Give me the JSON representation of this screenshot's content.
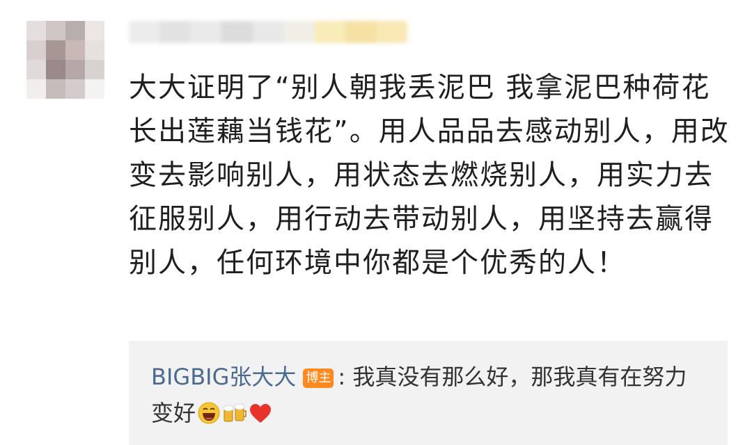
{
  "comment": {
    "text": "大大证明了“别人朝我丢泥巴 我拿泥巴种荷花 长出莲藕当钱花”。用人品品去感动别人，用改变去影响别人，用状态去燃烧别人，用实力去征服别人，用行动去带动别人，用坚持去赢得别人，任何环境中你都是个优秀的人！"
  },
  "reply": {
    "username": "BIGBIG张大大",
    "badge": "博主",
    "text": ":  我真没有那么好，那我真有在努力变好",
    "emojis": [
      "laughing-face-icon",
      "beer-mugs-icon",
      "red-heart-icon"
    ]
  },
  "colors": {
    "username_link": "#4a6b8f",
    "badge_bg": "#ff8a1f",
    "reply_bg": "#f2f2f2",
    "text": "#1f1f1f"
  }
}
